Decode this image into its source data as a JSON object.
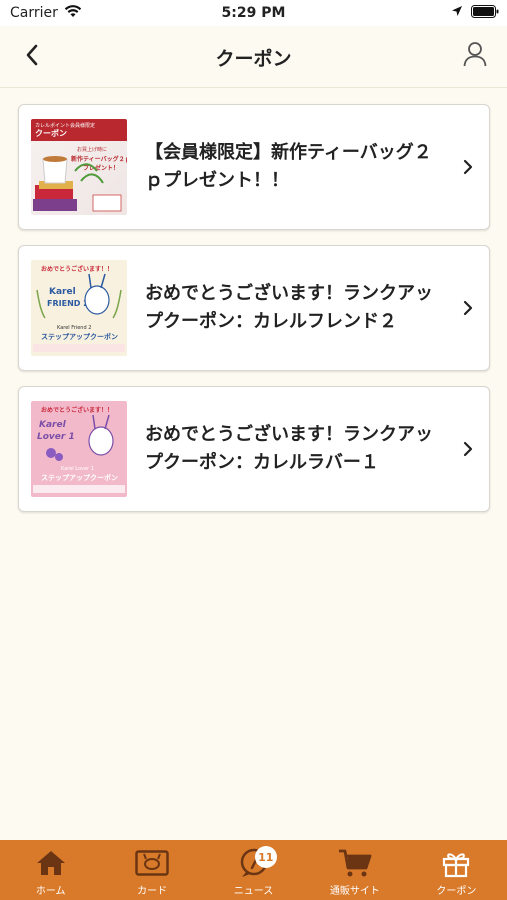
{
  "status_bar": {
    "carrier": "Carrier",
    "time": "5:29 PM"
  },
  "nav": {
    "title": "クーポン",
    "back_icon": "chevron-left-icon",
    "user_icon": "user-icon"
  },
  "coupons": [
    {
      "title": "【会員様限定】新作ティーバッグ２ｐプレゼント！！",
      "thumb_lines": [
        "カレルポイント会員様限定",
        "クーポン",
        "お買上げ時に",
        "新作ティーバッグ２ｐ",
        "プレゼント！"
      ]
    },
    {
      "title": "おめでとうございます！ランクアップクーポン：カレルフレンド２",
      "thumb_lines": [
        "おめでとうございます！！",
        "Karel",
        "FRIEND 2",
        "Karel Friend 2",
        "ステップアップクーポン"
      ]
    },
    {
      "title": "おめでとうございます！ランクアップクーポン：カレルラバー１",
      "thumb_lines": [
        "おめでとうございます！！",
        "Karel",
        "Lover 1",
        "Karel Lover 1",
        "ステップアップクーポン"
      ]
    }
  ],
  "tabs": [
    {
      "label": "ホーム",
      "icon": "home-icon"
    },
    {
      "label": "カード",
      "icon": "card-icon"
    },
    {
      "label": "ニュース",
      "icon": "news-icon",
      "badge": "11"
    },
    {
      "label": "通販サイト",
      "icon": "cart-icon"
    },
    {
      "label": "クーポン",
      "icon": "gift-icon",
      "active": true
    }
  ],
  "colors": {
    "tab_bar": "#d97a2b",
    "background": "#fdfaf1"
  }
}
